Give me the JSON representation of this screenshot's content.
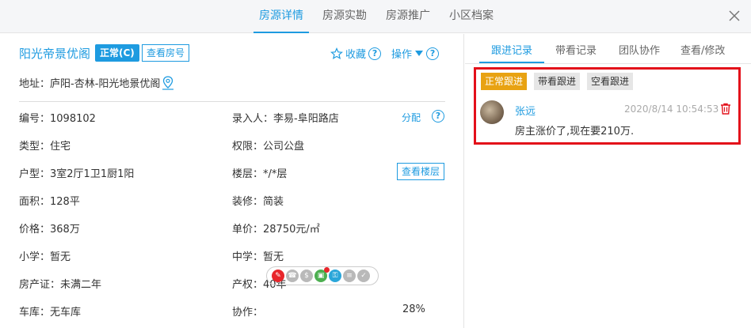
{
  "top_tabs": [
    "房源详情",
    "房源实勘",
    "房源推广",
    "小区档案"
  ],
  "house": {
    "name": "阳光帝景优阁",
    "status": "正常(C)",
    "view_number_label": "查看房号",
    "favorite_label": "收藏",
    "operate_label": "操作",
    "address": "地址：庐阳-杏林-阳光地景优阁"
  },
  "fields": {
    "code": "编号：1098102",
    "recorder": "录入人：李易-阜阳路店",
    "assign": "分配",
    "type": "类型：住宅",
    "permission": "权限：公司公盘",
    "layout": "户型：3室2厅1卫1厨1阳",
    "floor": "楼层：*/*层",
    "view_floor": "查看楼层",
    "area": "面积：128平",
    "decoration": "装修：简装",
    "price": "价格：368万",
    "unit_price": "单价：28750元/㎡",
    "primary_school": "小学：暂无",
    "middle_school": "中学：暂无",
    "certificate": "房产证：未满二年",
    "property_right": "产权：40年",
    "garage": "车库：无车库",
    "cooperation_label": "协作：",
    "cooperation_percent": "28%"
  },
  "right_tabs": [
    "跟进记录",
    "带看记录",
    "团队协作",
    "查看/修改"
  ],
  "followup_types": [
    "正常跟进",
    "带看跟进",
    "空看跟进"
  ],
  "followup": {
    "user": "张远",
    "time": "2020/8/14 10:54:53",
    "content": "房主涨价了,现在要210万."
  },
  "colors": {
    "accent": "#1e9be0",
    "highlight_border": "#e3101a",
    "active_followup": "#e8a212"
  }
}
